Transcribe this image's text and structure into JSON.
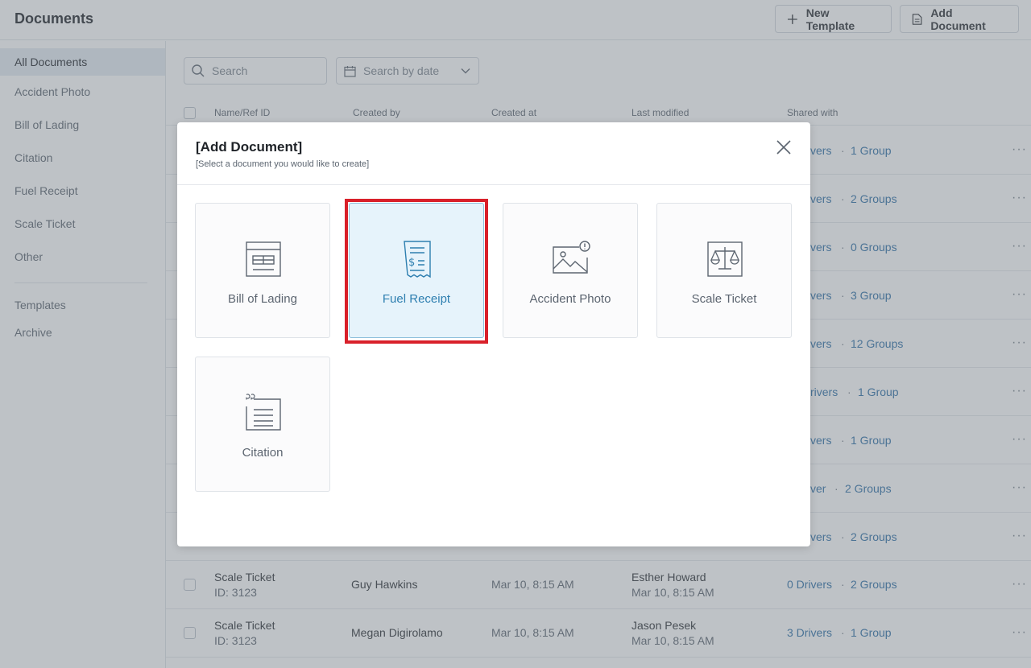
{
  "header": {
    "title": "Documents",
    "new_template": "New Template",
    "add_document": "Add Document"
  },
  "sidebar": {
    "items": [
      {
        "label": "All Documents",
        "active": true
      },
      {
        "label": "Accident Photo"
      },
      {
        "label": "Bill of Lading"
      },
      {
        "label": "Citation"
      },
      {
        "label": "Fuel Receipt"
      },
      {
        "label": "Scale Ticket"
      },
      {
        "label": "Other"
      }
    ],
    "secondary": [
      {
        "label": "Templates"
      },
      {
        "label": "Archive"
      }
    ]
  },
  "filters": {
    "search_placeholder": "Search",
    "date_placeholder": "Search by date"
  },
  "table": {
    "columns": [
      "Name/Ref ID",
      "Created by",
      "Created at",
      "Last modified",
      "Shared with"
    ],
    "partial_rows": [
      {
        "shared_drivers": "vers",
        "shared_groups": "1 Group"
      },
      {
        "shared_drivers": "vers",
        "shared_groups": "2 Groups"
      },
      {
        "shared_drivers": "vers",
        "shared_groups": "0 Groups"
      },
      {
        "shared_drivers": "vers",
        "shared_groups": "3 Group"
      },
      {
        "shared_drivers": "vers",
        "shared_groups": "12 Groups"
      },
      {
        "shared_drivers": "rivers",
        "shared_groups": "1 Group"
      },
      {
        "shared_drivers": "vers",
        "shared_groups": "1 Group"
      },
      {
        "shared_drivers": "ver",
        "shared_groups": "2 Groups"
      },
      {
        "shared_drivers": "vers",
        "shared_groups": "2 Groups"
      }
    ],
    "rows": [
      {
        "name": "Scale Ticket",
        "ref": "ID: 3123",
        "created_by": "Guy Hawkins",
        "created_at": "Mar 10, 8:15 AM",
        "modified_by": "Esther Howard",
        "modified_at": "Mar 10, 8:15 AM",
        "shared_drivers": "0 Drivers",
        "shared_groups": "2 Groups"
      },
      {
        "name": "Scale Ticket",
        "ref": "ID: 3123",
        "created_by": "Megan Digirolamo",
        "created_at": "Mar 10, 8:15 AM",
        "modified_by": "Jason Pesek",
        "modified_at": "Mar 10, 8:15 AM",
        "shared_drivers": "3 Drivers",
        "shared_groups": "1 Group"
      }
    ],
    "more_icon": "ellipsis-icon",
    "dot_separator": "·"
  },
  "modal": {
    "title": "[Add Document]",
    "subtitle": "[Select a document you would like to create]",
    "cards": [
      {
        "label": "Bill of Lading",
        "icon": "bill-of-lading-icon"
      },
      {
        "label": "Fuel Receipt",
        "icon": "fuel-receipt-icon",
        "selected": true
      },
      {
        "label": "Accident Photo",
        "icon": "accident-photo-icon"
      },
      {
        "label": "Scale Ticket",
        "icon": "scale-ticket-icon"
      },
      {
        "label": "Citation",
        "icon": "citation-icon"
      }
    ]
  },
  "colors": {
    "accent": "#2e7fb0",
    "link": "#2e6fa7",
    "selected_bg": "#e6f3fb",
    "highlight": "#d9202a"
  }
}
